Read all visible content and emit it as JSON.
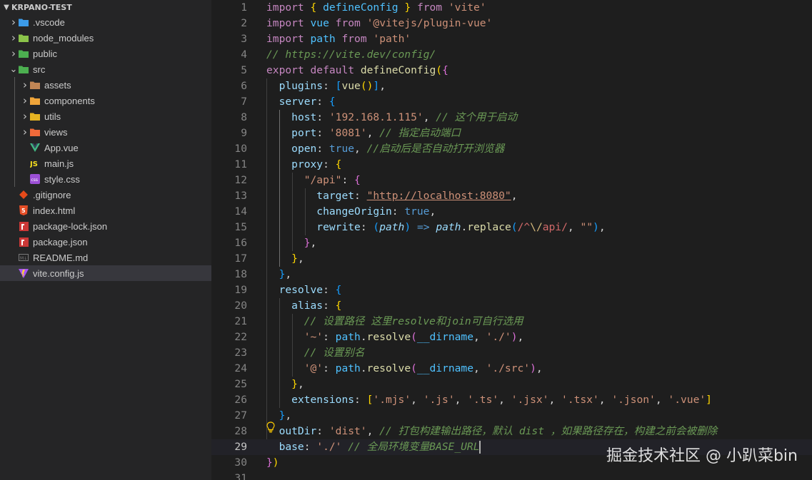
{
  "explorer": {
    "title": "KRPANO-TEST",
    "items": [
      {
        "label": ".vscode",
        "type": "folder",
        "icon": "vscode-folder-icon",
        "color": "#3c9be8"
      },
      {
        "label": "node_modules",
        "type": "folder",
        "icon": "node-folder-icon",
        "color": "#8bc34a"
      },
      {
        "label": "public",
        "type": "folder",
        "icon": "public-folder-icon",
        "color": "#4caf50"
      },
      {
        "label": "src",
        "type": "folder-open",
        "icon": "src-folder-icon",
        "color": "#4caf50"
      },
      {
        "label": "assets",
        "type": "folder",
        "icon": "assets-folder-icon",
        "color": "#c28655"
      },
      {
        "label": "components",
        "type": "folder",
        "icon": "components-folder-icon",
        "color": "#f0a53a"
      },
      {
        "label": "utils",
        "type": "folder",
        "icon": "utils-folder-icon",
        "color": "#e6b422"
      },
      {
        "label": "views",
        "type": "folder",
        "icon": "views-folder-icon",
        "color": "#f06a3a"
      },
      {
        "label": "App.vue",
        "type": "file",
        "icon": "vue-file-icon",
        "color": "#41b883"
      },
      {
        "label": "main.js",
        "type": "file",
        "icon": "js-file-icon",
        "color": "#f7df1e"
      },
      {
        "label": "style.css",
        "type": "file",
        "icon": "css-file-icon",
        "color": "#9c4fd6"
      },
      {
        "label": ".gitignore",
        "type": "file",
        "icon": "git-file-icon",
        "color": "#e64a19"
      },
      {
        "label": "index.html",
        "type": "file",
        "icon": "html-file-icon",
        "color": "#e44d26"
      },
      {
        "label": "package-lock.json",
        "type": "file",
        "icon": "npm-file-icon",
        "color": "#cb3837"
      },
      {
        "label": "package.json",
        "type": "file",
        "icon": "npm-file-icon",
        "color": "#cb3837"
      },
      {
        "label": "README.md",
        "type": "file",
        "icon": "markdown-file-icon",
        "color": "#7a7a7a"
      },
      {
        "label": "vite.config.js",
        "type": "file",
        "icon": "vite-file-icon",
        "color": "#a855f7",
        "selected": true
      }
    ]
  },
  "editor": {
    "current_line": 29,
    "lines": [
      {
        "n": "1",
        "t": [
          [
            "kw",
            "import"
          ],
          [
            "pun",
            " "
          ],
          [
            "bk1",
            "{"
          ],
          [
            "pun",
            " "
          ],
          [
            "var",
            "defineConfig"
          ],
          [
            "pun",
            " "
          ],
          [
            "bk1",
            "}"
          ],
          [
            "pun",
            " "
          ],
          [
            "kw",
            "from"
          ],
          [
            "pun",
            " "
          ],
          [
            "str",
            "'vite'"
          ]
        ]
      },
      {
        "n": "2",
        "t": [
          [
            "kw",
            "import"
          ],
          [
            "pun",
            " "
          ],
          [
            "var",
            "vue"
          ],
          [
            "pun",
            " "
          ],
          [
            "kw",
            "from"
          ],
          [
            "pun",
            " "
          ],
          [
            "str",
            "'@vitejs/plugin-vue'"
          ]
        ]
      },
      {
        "n": "3",
        "t": [
          [
            "kw",
            "import"
          ],
          [
            "pun",
            " "
          ],
          [
            "var",
            "path"
          ],
          [
            "pun",
            " "
          ],
          [
            "kw",
            "from"
          ],
          [
            "pun",
            " "
          ],
          [
            "str",
            "'path'"
          ]
        ]
      },
      {
        "n": "4",
        "t": [
          [
            "cm",
            "// https://vite.dev/config/"
          ]
        ]
      },
      {
        "n": "5",
        "t": [
          [
            "kw",
            "export"
          ],
          [
            "pun",
            " "
          ],
          [
            "kw",
            "default"
          ],
          [
            "pun",
            " "
          ],
          [
            "fn",
            "defineConfig"
          ],
          [
            "bk1",
            "("
          ],
          [
            "bk2",
            "{"
          ]
        ]
      },
      {
        "n": "6",
        "t": [
          [
            "pun",
            "  "
          ],
          [
            "prop",
            "plugins"
          ],
          [
            "pun",
            ": "
          ],
          [
            "bk3",
            "["
          ],
          [
            "fn",
            "vue"
          ],
          [
            "bk1",
            "()"
          ],
          [
            "bk3",
            "]"
          ],
          [
            "pun",
            ","
          ]
        ]
      },
      {
        "n": "7",
        "t": [
          [
            "pun",
            "  "
          ],
          [
            "prop",
            "server"
          ],
          [
            "pun",
            ": "
          ],
          [
            "bk3",
            "{"
          ]
        ]
      },
      {
        "n": "8",
        "t": [
          [
            "pun",
            "    "
          ],
          [
            "prop",
            "host"
          ],
          [
            "pun",
            ": "
          ],
          [
            "str",
            "'192.168.1.115'"
          ],
          [
            "pun",
            ", "
          ],
          [
            "cm",
            "// 这个用于启动"
          ]
        ]
      },
      {
        "n": "9",
        "t": [
          [
            "pun",
            "    "
          ],
          [
            "prop",
            "port"
          ],
          [
            "pun",
            ": "
          ],
          [
            "str",
            "'8081'"
          ],
          [
            "pun",
            ", "
          ],
          [
            "cm",
            "// 指定启动端口"
          ]
        ]
      },
      {
        "n": "10",
        "t": [
          [
            "pun",
            "    "
          ],
          [
            "prop",
            "open"
          ],
          [
            "pun",
            ": "
          ],
          [
            "kw2",
            "true"
          ],
          [
            "pun",
            ", "
          ],
          [
            "cm",
            "//启动后是否自动打开浏览器"
          ]
        ]
      },
      {
        "n": "11",
        "t": [
          [
            "pun",
            "    "
          ],
          [
            "prop",
            "proxy"
          ],
          [
            "pun",
            ": "
          ],
          [
            "bk1",
            "{"
          ]
        ]
      },
      {
        "n": "12",
        "t": [
          [
            "pun",
            "      "
          ],
          [
            "str",
            "\"/api\""
          ],
          [
            "pun",
            ": "
          ],
          [
            "bk2",
            "{"
          ]
        ]
      },
      {
        "n": "13",
        "t": [
          [
            "pun",
            "        "
          ],
          [
            "prop",
            "target"
          ],
          [
            "pun",
            ": "
          ],
          [
            "lnk",
            "\"http://localhost:8080\""
          ],
          [
            "pun",
            ","
          ]
        ]
      },
      {
        "n": "14",
        "t": [
          [
            "pun",
            "        "
          ],
          [
            "prop",
            "changeOrigin"
          ],
          [
            "pun",
            ": "
          ],
          [
            "kw2",
            "true"
          ],
          [
            "pun",
            ","
          ]
        ]
      },
      {
        "n": "15",
        "t": [
          [
            "pun",
            "        "
          ],
          [
            "prop",
            "rewrite"
          ],
          [
            "pun",
            ": "
          ],
          [
            "bk3",
            "("
          ],
          [
            "param",
            "path"
          ],
          [
            "bk3",
            ")"
          ],
          [
            "pun",
            " "
          ],
          [
            "kw2",
            "=>"
          ],
          [
            "pun",
            " "
          ],
          [
            "param",
            "path"
          ],
          [
            "pun",
            "."
          ],
          [
            "fn",
            "replace"
          ],
          [
            "bk3",
            "("
          ],
          [
            "rx",
            "/^"
          ],
          [
            "rxe",
            "\\/"
          ],
          [
            "rx",
            "api/"
          ],
          [
            "pun",
            ", "
          ],
          [
            "str",
            "\"\""
          ],
          [
            "bk3",
            ")"
          ],
          [
            "pun",
            ","
          ]
        ]
      },
      {
        "n": "16",
        "t": [
          [
            "pun",
            "      "
          ],
          [
            "bk2",
            "}"
          ],
          [
            "pun",
            ","
          ]
        ]
      },
      {
        "n": "17",
        "t": [
          [
            "pun",
            "    "
          ],
          [
            "bk1",
            "}"
          ],
          [
            "pun",
            ","
          ]
        ]
      },
      {
        "n": "18",
        "t": [
          [
            "pun",
            "  "
          ],
          [
            "bk3",
            "}"
          ],
          [
            "pun",
            ","
          ]
        ]
      },
      {
        "n": "19",
        "t": [
          [
            "pun",
            "  "
          ],
          [
            "prop",
            "resolve"
          ],
          [
            "pun",
            ": "
          ],
          [
            "bk3",
            "{"
          ]
        ]
      },
      {
        "n": "20",
        "t": [
          [
            "pun",
            "    "
          ],
          [
            "prop",
            "alias"
          ],
          [
            "pun",
            ": "
          ],
          [
            "bk1",
            "{"
          ]
        ]
      },
      {
        "n": "21",
        "t": [
          [
            "pun",
            "      "
          ],
          [
            "cm",
            "// 设置路径 这里resolve和join可自行选用"
          ]
        ]
      },
      {
        "n": "22",
        "t": [
          [
            "pun",
            "      "
          ],
          [
            "str",
            "'~'"
          ],
          [
            "pun",
            ": "
          ],
          [
            "var",
            "path"
          ],
          [
            "pun",
            "."
          ],
          [
            "fn",
            "resolve"
          ],
          [
            "bk2",
            "("
          ],
          [
            "var",
            "__dirname"
          ],
          [
            "pun",
            ", "
          ],
          [
            "str",
            "'./'"
          ],
          [
            "bk2",
            ")"
          ],
          [
            "pun",
            ","
          ]
        ]
      },
      {
        "n": "23",
        "t": [
          [
            "pun",
            "      "
          ],
          [
            "cm",
            "// 设置别名"
          ]
        ]
      },
      {
        "n": "24",
        "t": [
          [
            "pun",
            "      "
          ],
          [
            "str",
            "'@'"
          ],
          [
            "pun",
            ": "
          ],
          [
            "var",
            "path"
          ],
          [
            "pun",
            "."
          ],
          [
            "fn",
            "resolve"
          ],
          [
            "bk2",
            "("
          ],
          [
            "var",
            "__dirname"
          ],
          [
            "pun",
            ", "
          ],
          [
            "str",
            "'./src'"
          ],
          [
            "bk2",
            ")"
          ],
          [
            "pun",
            ","
          ]
        ]
      },
      {
        "n": "25",
        "t": [
          [
            "pun",
            "    "
          ],
          [
            "bk1",
            "}"
          ],
          [
            "pun",
            ","
          ]
        ]
      },
      {
        "n": "26",
        "t": [
          [
            "pun",
            "    "
          ],
          [
            "prop",
            "extensions"
          ],
          [
            "pun",
            ": "
          ],
          [
            "bk1",
            "["
          ],
          [
            "str",
            "'.mjs'"
          ],
          [
            "pun",
            ", "
          ],
          [
            "str",
            "'.js'"
          ],
          [
            "pun",
            ", "
          ],
          [
            "str",
            "'.ts'"
          ],
          [
            "pun",
            ", "
          ],
          [
            "str",
            "'.jsx'"
          ],
          [
            "pun",
            ", "
          ],
          [
            "str",
            "'.tsx'"
          ],
          [
            "pun",
            ", "
          ],
          [
            "str",
            "'.json'"
          ],
          [
            "pun",
            ", "
          ],
          [
            "str",
            "'.vue'"
          ],
          [
            "bk1",
            "]"
          ]
        ]
      },
      {
        "n": "27",
        "t": [
          [
            "pun",
            "  "
          ],
          [
            "bk3",
            "}"
          ],
          [
            "pun",
            ","
          ]
        ]
      },
      {
        "n": "28",
        "t": [
          [
            "pun",
            "  "
          ],
          [
            "prop",
            "outDir"
          ],
          [
            "pun",
            ": "
          ],
          [
            "str",
            "'dist'"
          ],
          [
            "pun",
            ", "
          ],
          [
            "cm",
            "// 打包构建输出路径，默认 dist ，如果路径存在，构建之前会被删除"
          ]
        ]
      },
      {
        "n": "29",
        "t": [
          [
            "pun",
            "  "
          ],
          [
            "prop",
            "base"
          ],
          [
            "pun",
            ": "
          ],
          [
            "str",
            "'./'"
          ],
          [
            "pun",
            " "
          ],
          [
            "cm",
            "// 全局环境变量BASE_URL"
          ]
        ]
      },
      {
        "n": "30",
        "t": [
          [
            "bk2",
            "}"
          ],
          [
            "bk1",
            ")"
          ]
        ]
      },
      {
        "n": "31",
        "t": []
      }
    ]
  },
  "watermark": "掘金技术社区 @ 小趴菜bin"
}
